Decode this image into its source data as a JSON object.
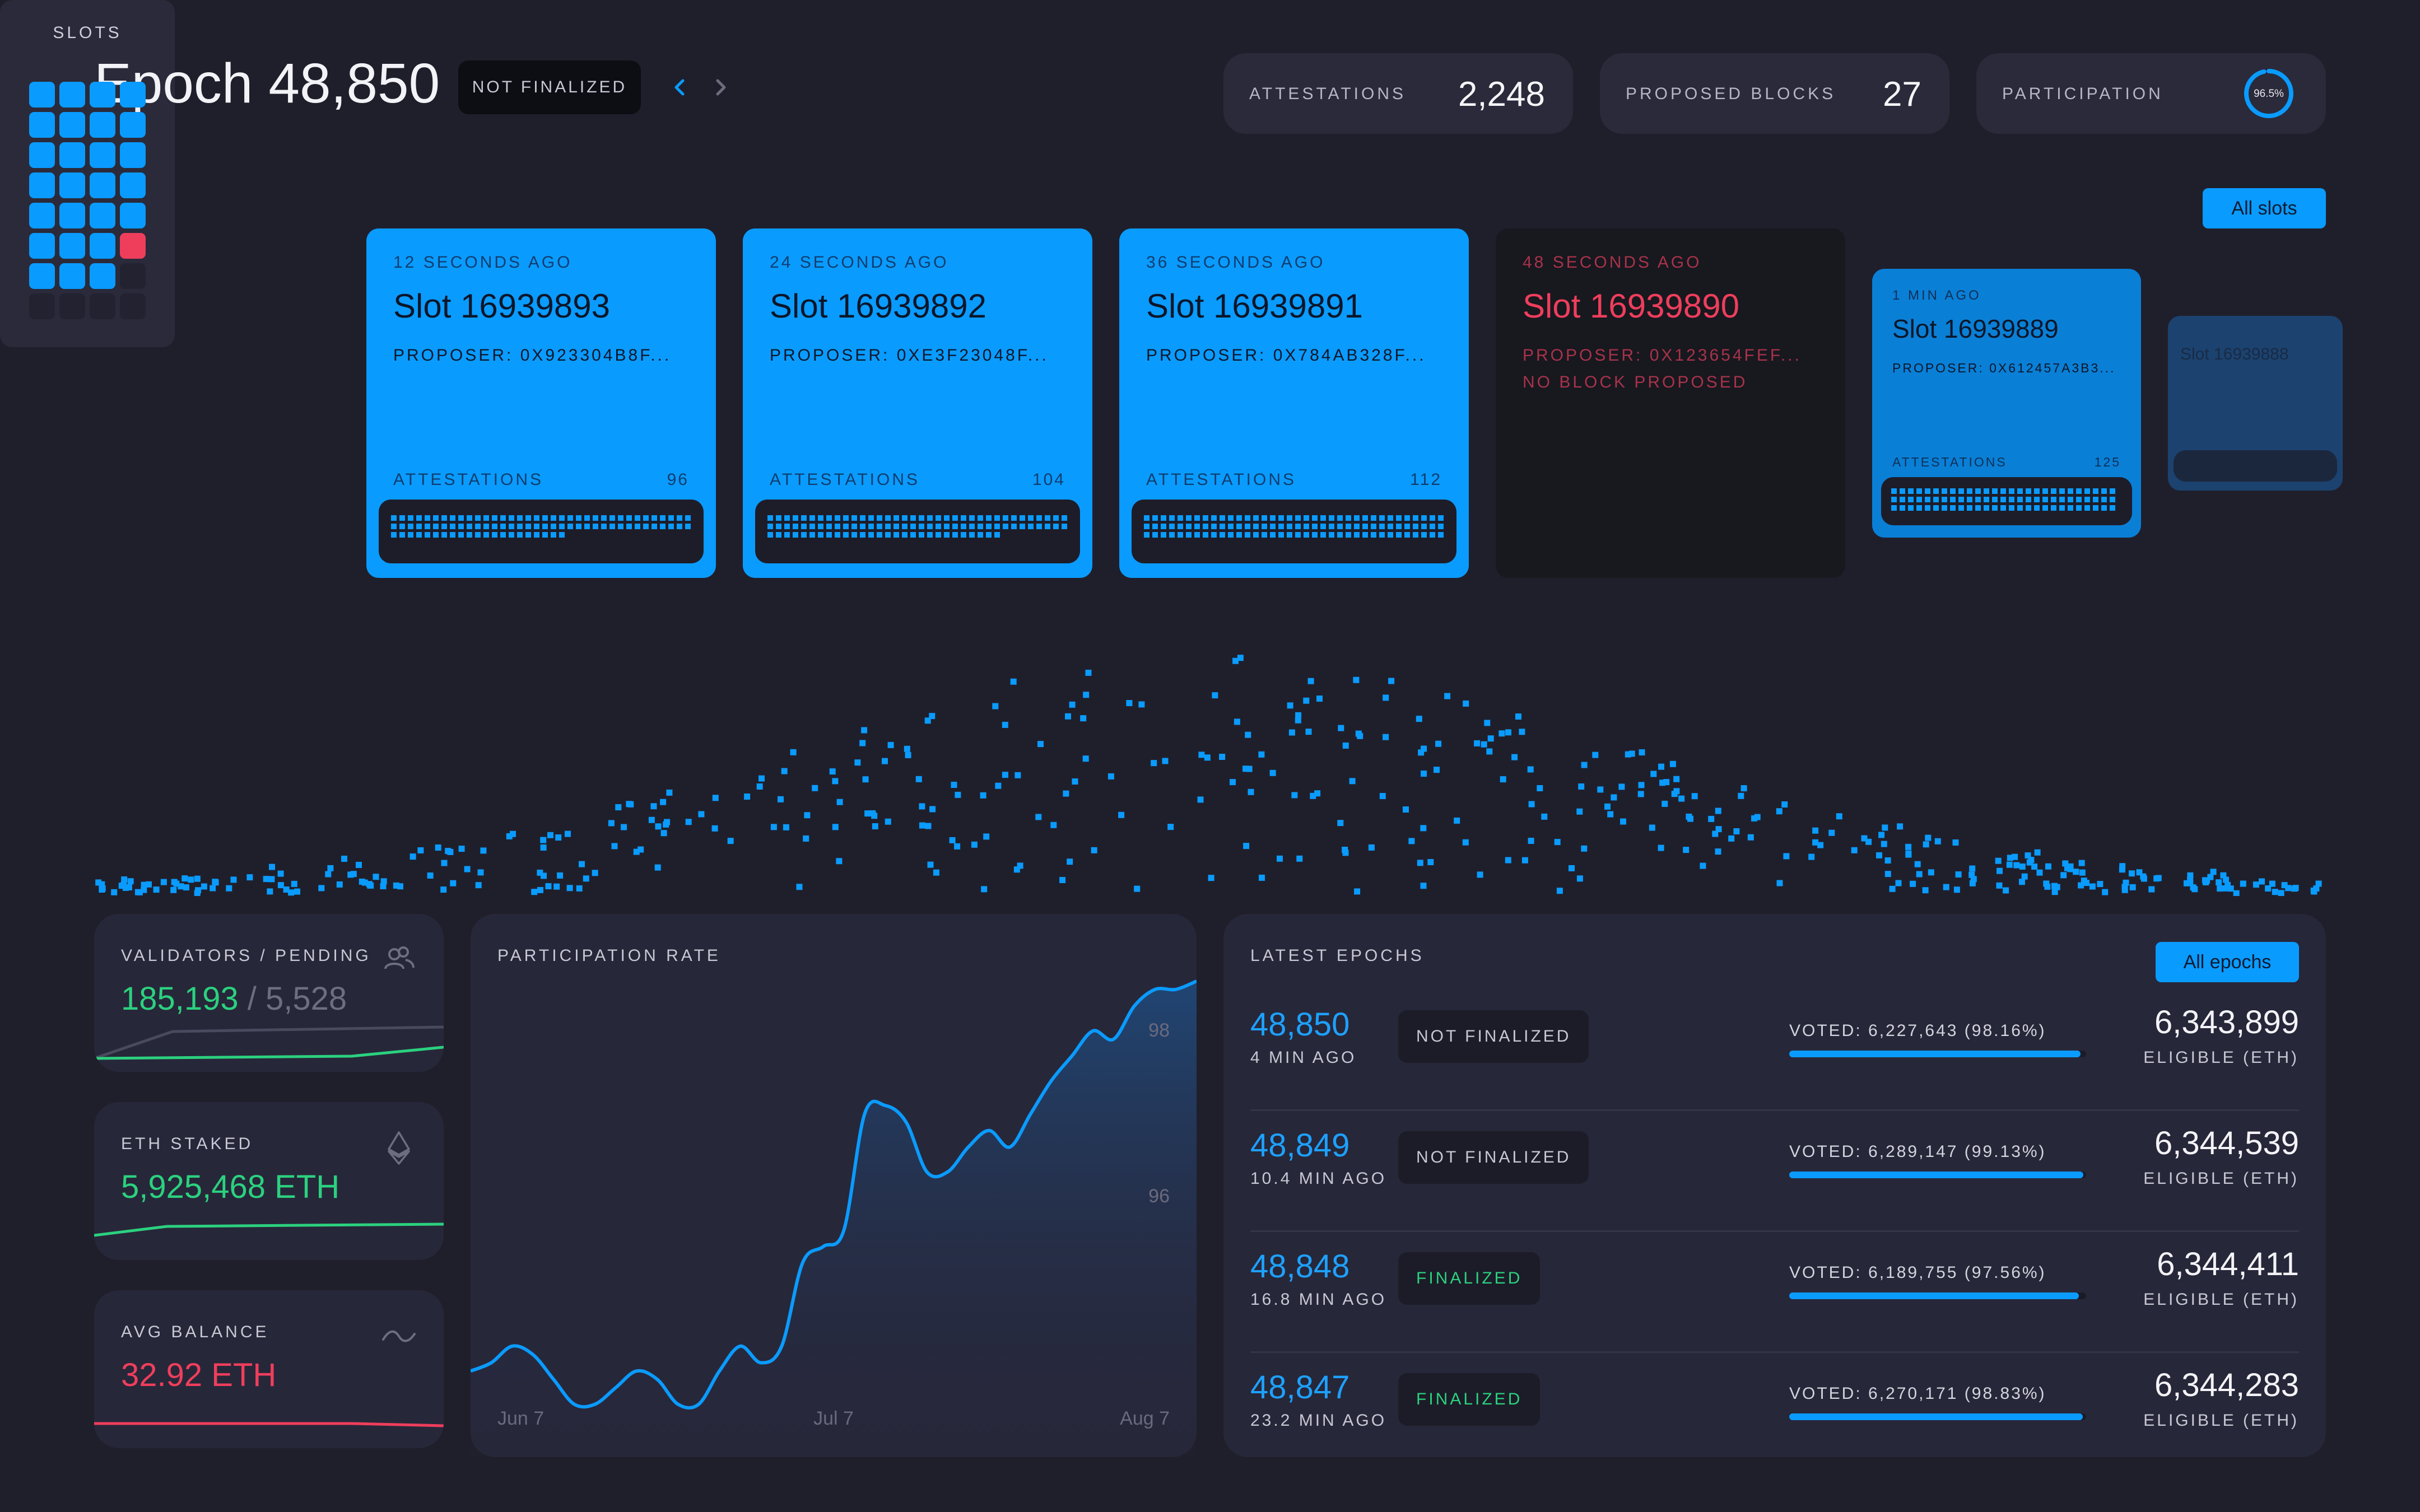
{
  "header": {
    "epoch_title": "Epoch 48,850",
    "finality_badge": "NOT FINALIZED",
    "stats": [
      {
        "label": "ATTESTATIONS",
        "value": "2,248"
      },
      {
        "label": "PROPOSED BLOCKS",
        "value": "27"
      },
      {
        "label": "PARTICIPATION",
        "value": "96.5%",
        "fraction": 0.965
      }
    ]
  },
  "slots_panel": {
    "title": "SLOTS",
    "states": [
      "proposed",
      "proposed",
      "proposed",
      "proposed",
      "proposed",
      "proposed",
      "proposed",
      "proposed",
      "proposed",
      "proposed",
      "proposed",
      "proposed",
      "proposed",
      "proposed",
      "proposed",
      "proposed",
      "proposed",
      "proposed",
      "proposed",
      "proposed",
      "proposed",
      "proposed",
      "proposed",
      "missed",
      "proposed",
      "proposed",
      "proposed",
      "empty",
      "empty",
      "empty",
      "empty",
      "empty"
    ]
  },
  "all_slots_button": "All slots",
  "slot_cards": [
    {
      "ago": "12 SECONDS AGO",
      "name": "Slot 16939893",
      "proposer": "PROPOSER: 0X923304B8F...",
      "att_label": "ATTESTATIONS",
      "att_count": "96",
      "status": "proposed",
      "att_fill": 0.86
    },
    {
      "ago": "24 SECONDS AGO",
      "name": "Slot 16939892",
      "proposer": "PROPOSER: 0XE3F23048F...",
      "att_label": "ATTESTATIONS",
      "att_count": "104",
      "status": "proposed",
      "att_fill": 0.93
    },
    {
      "ago": "36 SECONDS AGO",
      "name": "Slot 16939891",
      "proposer": "PROPOSER: 0X784AB328F...",
      "att_label": "ATTESTATIONS",
      "att_count": "112",
      "status": "proposed",
      "att_fill": 1.0
    },
    {
      "ago": "48 SECONDS AGO",
      "name": "Slot 16939890",
      "proposer": "PROPOSER: 0X123654FEF...",
      "note": "NO BLOCK PROPOSED",
      "status": "missed"
    },
    {
      "ago": "1 MIN AGO",
      "name": "Slot 16939889",
      "proposer": "PROPOSER: 0X612457A3B3...",
      "att_label": "ATTESTATIONS",
      "att_count": "125",
      "status": "proposed",
      "att_fill": 1.0
    },
    {
      "name": "Slot 16939888",
      "status": "faded"
    }
  ],
  "validators": {
    "label": "VALIDATORS / PENDING",
    "value": "185,193",
    "pending": "/ 5,528",
    "icon": "users-icon",
    "color": "#2bd17e"
  },
  "eth_staked": {
    "label": "ETH STAKED",
    "value": "5,925,468 ETH",
    "icon": "ethereum-icon",
    "color": "#2bd17e"
  },
  "avg_balance": {
    "label": "AVG BALANCE",
    "value": "32.92 ETH",
    "icon": "tilde-wave-icon",
    "color": "#ef3e5c"
  },
  "participation_chart": {
    "title": "PARTICIPATION RATE",
    "chart_data": {
      "type": "area",
      "x_ticks": [
        "Jun 7",
        "Jul 7",
        "Aug 7"
      ],
      "y_ticks": [
        96,
        98
      ],
      "ylim": [
        93.2,
        98.6
      ],
      "x_domain": [
        "2023-06-07",
        "2023-08-07"
      ],
      "series": [
        {
          "x": [
            "2023-06-01",
            "2023-06-03",
            "2023-06-05",
            "2023-06-07",
            "2023-06-09",
            "2023-06-11",
            "2023-06-13",
            "2023-06-15",
            "2023-06-17",
            "2023-06-19",
            "2023-06-21",
            "2023-06-23",
            "2023-06-25",
            "2023-06-27",
            "2023-06-29",
            "2023-07-01",
            "2023-07-03",
            "2023-07-05",
            "2023-07-07",
            "2023-07-09",
            "2023-07-11",
            "2023-07-13",
            "2023-07-15",
            "2023-07-17",
            "2023-07-19",
            "2023-07-21",
            "2023-07-23",
            "2023-07-25",
            "2023-07-27",
            "2023-07-29",
            "2023-07-31",
            "2023-08-02",
            "2023-08-04",
            "2023-08-06",
            "2023-08-08",
            "2023-08-10"
          ],
          "y": [
            93.9,
            94.0,
            94.2,
            94.1,
            93.8,
            93.5,
            93.5,
            93.7,
            93.9,
            93.8,
            93.5,
            93.5,
            93.9,
            94.2,
            94.0,
            94.2,
            95.2,
            95.4,
            95.6,
            97.0,
            97.1,
            96.9,
            96.3,
            96.3,
            96.6,
            96.8,
            96.6,
            97.0,
            97.4,
            97.7,
            98.0,
            97.9,
            98.3,
            98.5,
            98.5,
            98.6
          ]
        }
      ]
    }
  },
  "latest_epochs": {
    "title": "LATEST EPOCHS",
    "all_button": "All epochs",
    "rows": [
      {
        "epoch": "48,850",
        "ago": "4 MIN AGO",
        "status": "NOT FINALIZED",
        "finalized": false,
        "voted": "VOTED: 6,227,643 (98.16%)",
        "voted_fraction": 0.9816,
        "eligible": "6,343,899",
        "eligible_label": "ELIGIBLE (ETH)"
      },
      {
        "epoch": "48,849",
        "ago": "10.4 MIN AGO",
        "status": "NOT FINALIZED",
        "finalized": false,
        "voted": "VOTED: 6,289,147 (99.13%)",
        "voted_fraction": 0.9913,
        "eligible": "6,344,539",
        "eligible_label": "ELIGIBLE (ETH)"
      },
      {
        "epoch": "48,848",
        "ago": "16.8 MIN AGO",
        "status": "FINALIZED",
        "finalized": true,
        "voted": "VOTED: 6,189,755 (97.56%)",
        "voted_fraction": 0.9756,
        "eligible": "6,344,411",
        "eligible_label": "ELIGIBLE (ETH)"
      },
      {
        "epoch": "48,847",
        "ago": "23.2 MIN AGO",
        "status": "FINALIZED",
        "finalized": true,
        "voted": "VOTED: 6,270,171 (98.83%)",
        "voted_fraction": 0.9883,
        "eligible": "6,344,283",
        "eligible_label": "ELIGIBLE (ETH)"
      }
    ]
  },
  "colors": {
    "accent": "#0a9bff",
    "positive": "#2bd17e",
    "negative": "#ef3e5c",
    "background": "#1f1f2b",
    "panel": "#27273a"
  }
}
